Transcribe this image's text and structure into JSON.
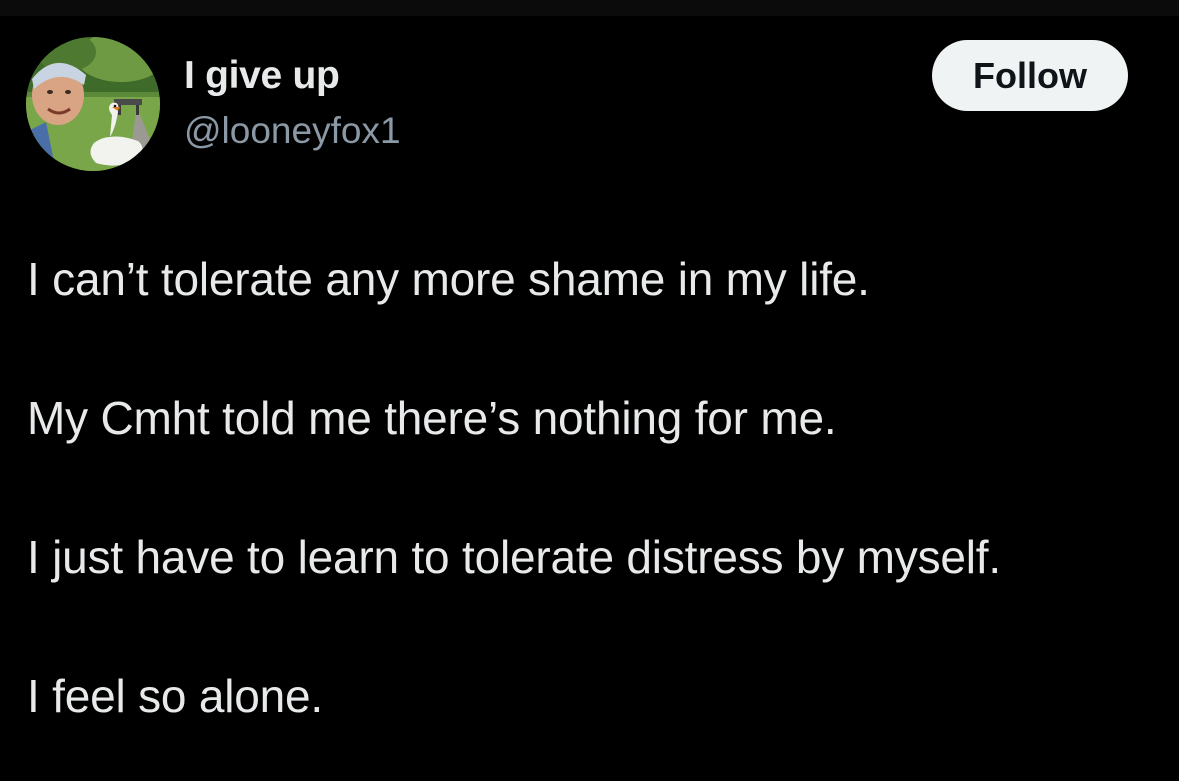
{
  "colors": {
    "background": "#000000",
    "text_primary": "#e7e9ea",
    "text_secondary": "#8b98a5",
    "follow_button_bg": "#eff3f4",
    "follow_button_text": "#0f1419"
  },
  "author": {
    "display_name": "I give up",
    "handle": "@looneyfox1",
    "avatar_icon": "profile-photo-person-with-swan"
  },
  "actions": {
    "follow_label": "Follow"
  },
  "tweet": {
    "lines": [
      "I can’t tolerate any more shame in my life.",
      "My Cmht told me there’s nothing for me.",
      "I just have to learn to tolerate distress by myself.",
      "I feel so alone."
    ]
  }
}
